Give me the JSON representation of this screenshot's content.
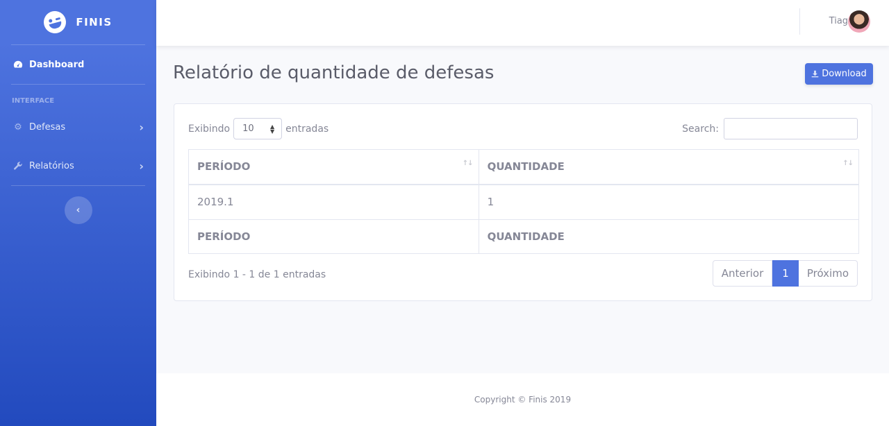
{
  "sidebar": {
    "brand": "FINIS",
    "dashboard_label": "Dashboard",
    "heading": "INTERFACE",
    "items": [
      {
        "label": "Defesas",
        "icon": "gear-icon"
      },
      {
        "label": "Relatórios",
        "icon": "wrench-icon"
      }
    ],
    "toggle_icon": "chevron-left-icon"
  },
  "topbar": {
    "user_name": "Tiago"
  },
  "page": {
    "title": "Relatório de quantidade de defesas",
    "download_label": "Download"
  },
  "table_controls": {
    "show_prefix": "Exibindo",
    "page_size": "10",
    "show_suffix": "entradas",
    "search_label": "Search:"
  },
  "table": {
    "headers": [
      "PERÍODO",
      "QUANTIDADE"
    ],
    "rows": [
      [
        "2019.1",
        "1"
      ]
    ],
    "footers": [
      "PERÍODO",
      "QUANTIDADE"
    ]
  },
  "pagination": {
    "info": "Exibindo 1 - 1 de 1 entradas",
    "prev": "Anterior",
    "current": "1",
    "next": "Próximo"
  },
  "footer": {
    "copyright": "Copyright © Finis 2019"
  },
  "colors": {
    "primary": "#4e73df",
    "sidebar_dark": "#224abe",
    "text": "#858796",
    "title": "#5a5c69"
  }
}
